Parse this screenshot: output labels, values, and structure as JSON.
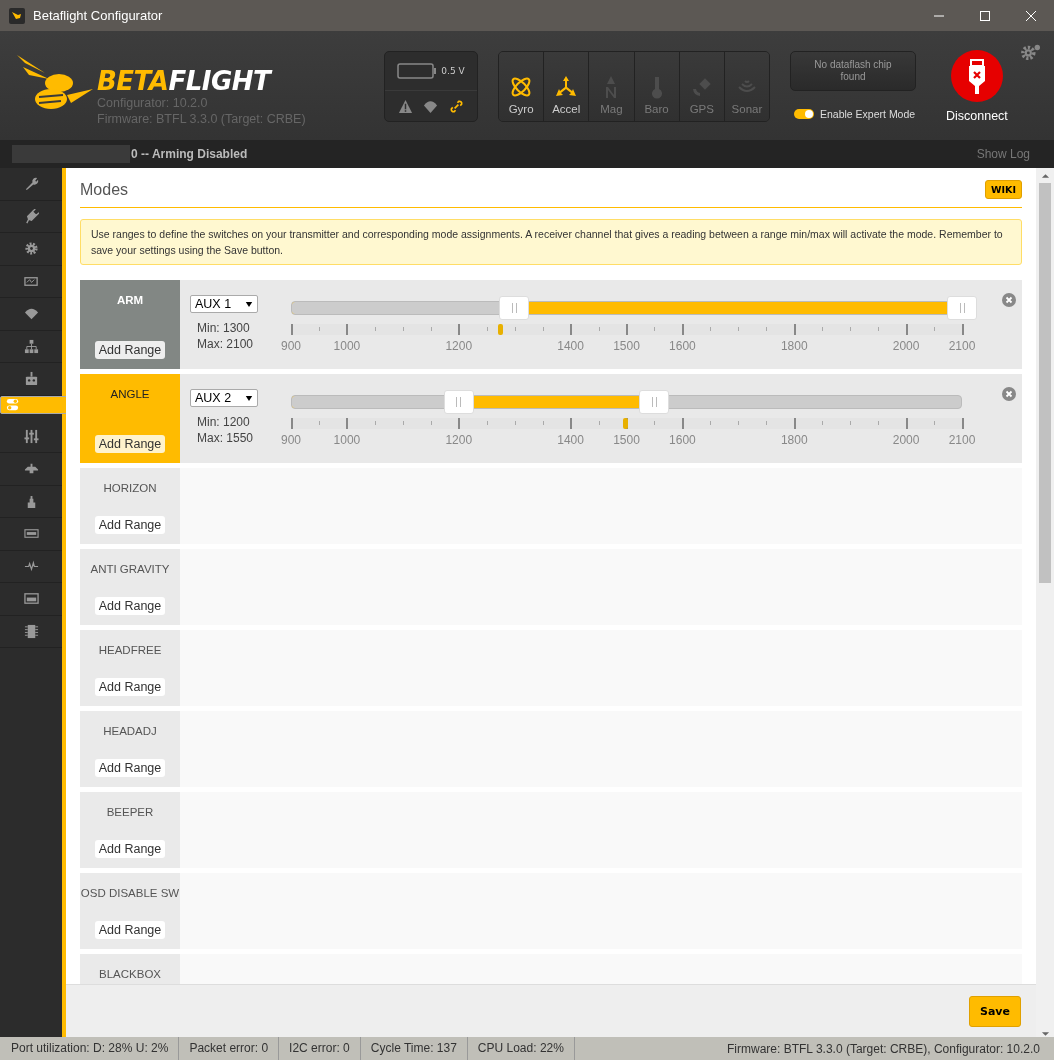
{
  "window": {
    "title": "Betaflight Configurator"
  },
  "header": {
    "logo_a": "BETA",
    "logo_b": "FLIGHT",
    "configurator": "Configurator: 10.2.0",
    "firmware": "Firmware: BTFL 3.3.0 (Target: CRBE)",
    "battery": "0.5 V",
    "sensors": [
      {
        "label": "Gyro",
        "on": true
      },
      {
        "label": "Accel",
        "on": true
      },
      {
        "label": "Mag",
        "on": false
      },
      {
        "label": "Baro",
        "on": false
      },
      {
        "label": "GPS",
        "on": false
      },
      {
        "label": "Sonar",
        "on": false
      }
    ],
    "dataflash": "No dataflash chip found",
    "expert_mode": {
      "label": "Enable Expert Mode",
      "on": true
    },
    "disconnect": "Disconnect"
  },
  "status": {
    "text": "0 -- Arming Disabled",
    "show_log": "Show Log"
  },
  "sidebar": {
    "items": [
      {
        "selected": false
      },
      {
        "selected": false
      },
      {
        "selected": false
      },
      {
        "selected": false
      },
      {
        "selected": false
      },
      {
        "selected": false
      },
      {
        "selected": false
      },
      {
        "selected": true
      },
      {
        "selected": false
      },
      {
        "selected": false
      },
      {
        "selected": false
      },
      {
        "selected": false
      },
      {
        "selected": false
      },
      {
        "selected": false
      },
      {
        "selected": false
      }
    ]
  },
  "page": {
    "title": "Modes",
    "wiki": "WIKI",
    "note": "Use ranges to define the switches on your transmitter and corresponding mode assignments. A receiver channel that gives a reading between a range min/max will activate the mode. Remember to save your settings using the Save button.",
    "save": "Save"
  },
  "modes": [
    {
      "name": "ARM",
      "active": false,
      "add_range": "Add Range",
      "ranges": [
        {
          "channel": "AUX 1",
          "min": "Min: 1300",
          "max": "Max: 2100",
          "low": {
            "level": 0.333
          },
          "high": {
            "level": 1
          },
          "marker": {
            "level": 0.311
          },
          "ticks": [
            {
              "major": true,
              "label": "900"
            },
            {
              "major": false
            },
            {
              "major": true,
              "label": "1000"
            },
            {
              "major": false
            },
            {
              "major": false
            },
            {
              "major": false
            },
            {
              "major": true,
              "label": "1200"
            },
            {
              "major": false
            },
            {
              "major": false
            },
            {
              "major": false
            },
            {
              "major": true,
              "label": "1400"
            },
            {
              "major": false
            },
            {
              "major": true,
              "label": "1500"
            },
            {
              "major": false
            },
            {
              "major": true,
              "label": "1600"
            },
            {
              "major": false
            },
            {
              "major": false
            },
            {
              "major": false
            },
            {
              "major": true,
              "label": "1800"
            },
            {
              "major": false
            },
            {
              "major": false
            },
            {
              "major": false
            },
            {
              "major": true,
              "label": "2000"
            },
            {
              "major": false
            },
            {
              "major": true,
              "label": "2100"
            }
          ]
        }
      ]
    },
    {
      "name": "ANGLE",
      "active": true,
      "add_range": "Add Range",
      "ranges": [
        {
          "channel": "AUX 2",
          "min": "Min: 1200",
          "max": "Max: 1550",
          "low": {
            "level": 0.25
          },
          "high": {
            "level": 0.5417
          },
          "marker": {
            "level": 0.498
          },
          "ticks": [
            {
              "major": true,
              "label": "900"
            },
            {
              "major": false
            },
            {
              "major": true,
              "label": "1000"
            },
            {
              "major": false
            },
            {
              "major": false
            },
            {
              "major": false
            },
            {
              "major": true,
              "label": "1200"
            },
            {
              "major": false
            },
            {
              "major": false
            },
            {
              "major": false
            },
            {
              "major": true,
              "label": "1400"
            },
            {
              "major": false
            },
            {
              "major": true,
              "label": "1500"
            },
            {
              "major": false
            },
            {
              "major": true,
              "label": "1600"
            },
            {
              "major": false
            },
            {
              "major": false
            },
            {
              "major": false
            },
            {
              "major": true,
              "label": "1800"
            },
            {
              "major": false
            },
            {
              "major": false
            },
            {
              "major": false
            },
            {
              "major": true,
              "label": "2000"
            },
            {
              "major": false
            },
            {
              "major": true,
              "label": "2100"
            }
          ]
        }
      ]
    },
    {
      "name": "HORIZON",
      "active": false,
      "add_range": "Add Range"
    },
    {
      "name": "ANTI GRAVITY",
      "active": false,
      "add_range": "Add Range"
    },
    {
      "name": "HEADFREE",
      "active": false,
      "add_range": "Add Range"
    },
    {
      "name": "HEADADJ",
      "active": false,
      "add_range": "Add Range"
    },
    {
      "name": "BEEPER",
      "active": false,
      "add_range": "Add Range"
    },
    {
      "name": "OSD DISABLE SW",
      "active": false,
      "add_range": "Add Range"
    },
    {
      "name": "BLACKBOX",
      "active": false
    }
  ],
  "footer": {
    "cells": [
      "Port utilization: D: 28% U: 2%",
      "Packet error: 0",
      "I2C error: 0",
      "Cycle Time: 137",
      "CPU Load: 22%"
    ],
    "right": "Firmware: BTFL 3.3.0 (Target: CRBE), Configurator: 10.2.0"
  }
}
